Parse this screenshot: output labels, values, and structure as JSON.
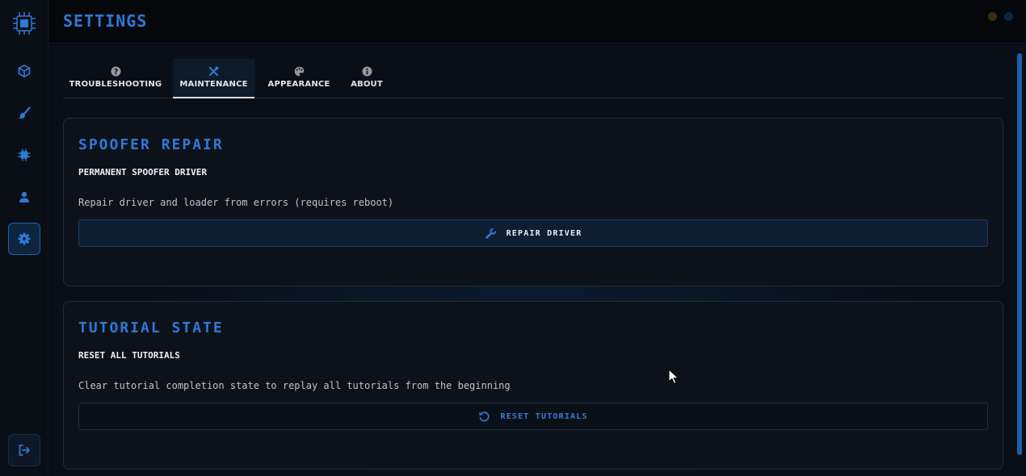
{
  "header": {
    "title": "SETTINGS"
  },
  "sidebar": {
    "items": [
      {
        "name": "cube-icon"
      },
      {
        "name": "brush-icon"
      },
      {
        "name": "chip-icon"
      },
      {
        "name": "user-icon"
      },
      {
        "name": "gear-icon",
        "active": true
      }
    ],
    "logout": {
      "name": "logout-icon"
    }
  },
  "tabs": [
    {
      "label": "TROUBLESHOOTING",
      "icon": "question-icon"
    },
    {
      "label": "MAINTENANCE",
      "icon": "tools-icon",
      "active": true
    },
    {
      "label": "APPEARANCE",
      "icon": "palette-icon"
    },
    {
      "label": "ABOUT",
      "icon": "info-icon"
    }
  ],
  "cards": [
    {
      "title": "SPOOFER REPAIR",
      "subtitle": "PERMANENT SPOOFER DRIVER",
      "description": "Repair driver and loader from errors (requires reboot)",
      "button": {
        "label": "REPAIR DRIVER",
        "icon": "wrench-icon"
      }
    },
    {
      "title": "TUTORIAL STATE",
      "subtitle": "RESET ALL TUTORIALS",
      "description": "Clear tutorial completion state to replay all tutorials from the beginning",
      "button": {
        "label": "RESET TUTORIALS",
        "icon": "refresh-icon"
      }
    }
  ],
  "colors": {
    "accent": "#2a7bd6",
    "background": "#0a0e16",
    "card": "#0d1119"
  }
}
